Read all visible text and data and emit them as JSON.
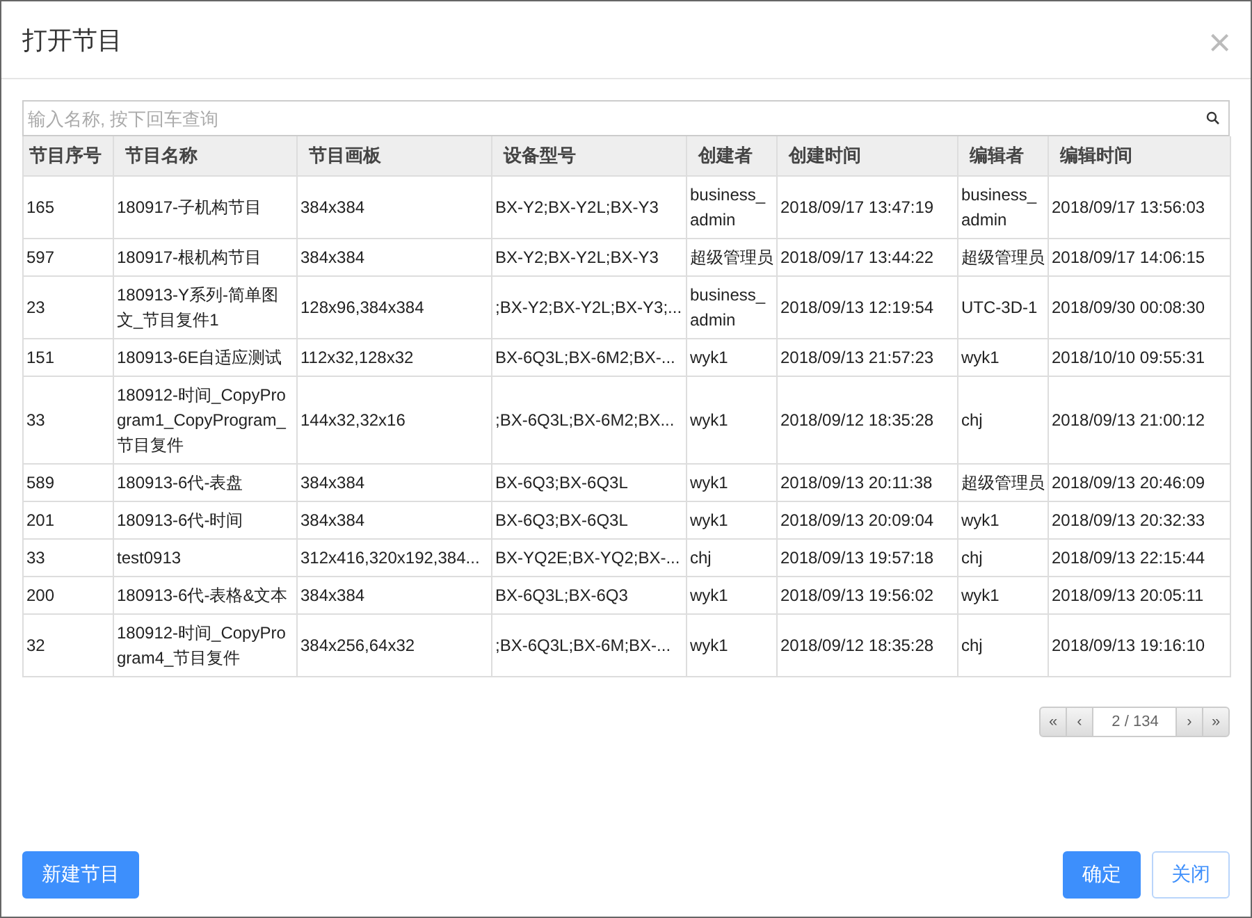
{
  "dialog": {
    "title": "打开节目",
    "close": "×"
  },
  "search": {
    "placeholder": "输入名称, 按下回车查询"
  },
  "table": {
    "columns": [
      "节目序号",
      "节目名称",
      "节目画板",
      "设备型号",
      "创建者",
      "创建时间",
      "编辑者",
      "编辑时间"
    ],
    "rows": [
      [
        "165",
        "180917-子机构节目",
        "384x384",
        "BX-Y2;BX-Y2L;BX-Y3",
        "business_admin",
        "2018/09/17 13:47:19",
        "business_admin",
        "2018/09/17 13:56:03"
      ],
      [
        "597",
        "180917-根机构节目",
        "384x384",
        "BX-Y2;BX-Y2L;BX-Y3",
        "超级管理员",
        "2018/09/17 13:44:22",
        "超级管理员",
        "2018/09/17 14:06:15"
      ],
      [
        "23",
        "180913-Y系列-简单图文_节目复件1",
        "128x96,384x384",
        ";BX-Y2;BX-Y2L;BX-Y3;...",
        "business_admin",
        "2018/09/13 12:19:54",
        "UTC-3D-1",
        "2018/09/30 00:08:30"
      ],
      [
        "151",
        "180913-6E自适应测试",
        "112x32,128x32",
        "BX-6Q3L;BX-6M2;BX-...",
        "wyk1",
        "2018/09/13 21:57:23",
        "wyk1",
        "2018/10/10 09:55:31"
      ],
      [
        "33",
        "180912-时间_CopyProgram1_CopyProgram_节目复件",
        "144x32,32x16",
        ";BX-6Q3L;BX-6M2;BX...",
        "wyk1",
        "2018/09/12 18:35:28",
        "chj",
        "2018/09/13 21:00:12"
      ],
      [
        "589",
        "180913-6代-表盘",
        "384x384",
        "BX-6Q3;BX-6Q3L",
        "wyk1",
        "2018/09/13 20:11:38",
        "超级管理员",
        "2018/09/13 20:46:09"
      ],
      [
        "201",
        "180913-6代-时间",
        "384x384",
        "BX-6Q3;BX-6Q3L",
        "wyk1",
        "2018/09/13 20:09:04",
        "wyk1",
        "2018/09/13 20:32:33"
      ],
      [
        "33",
        "test0913",
        "312x416,320x192,384...",
        "BX-YQ2E;BX-YQ2;BX-...",
        "chj",
        "2018/09/13 19:57:18",
        "chj",
        "2018/09/13 22:15:44"
      ],
      [
        "200",
        "180913-6代-表格&文本",
        "384x384",
        "BX-6Q3L;BX-6Q3",
        "wyk1",
        "2018/09/13 19:56:02",
        "wyk1",
        "2018/09/13 20:05:11"
      ],
      [
        "32",
        "180912-时间_CopyProgram4_节目复件",
        "384x256,64x32",
        ";BX-6Q3L;BX-6M;BX-...",
        "wyk1",
        "2018/09/12 18:35:28",
        "chj",
        "2018/09/13 19:16:10"
      ]
    ]
  },
  "pagination": {
    "first": "«",
    "prev": "‹",
    "page": "2 / 134",
    "next": "›",
    "last": "»"
  },
  "buttons": {
    "new": "新建节目",
    "ok": "确定",
    "close": "关闭"
  }
}
